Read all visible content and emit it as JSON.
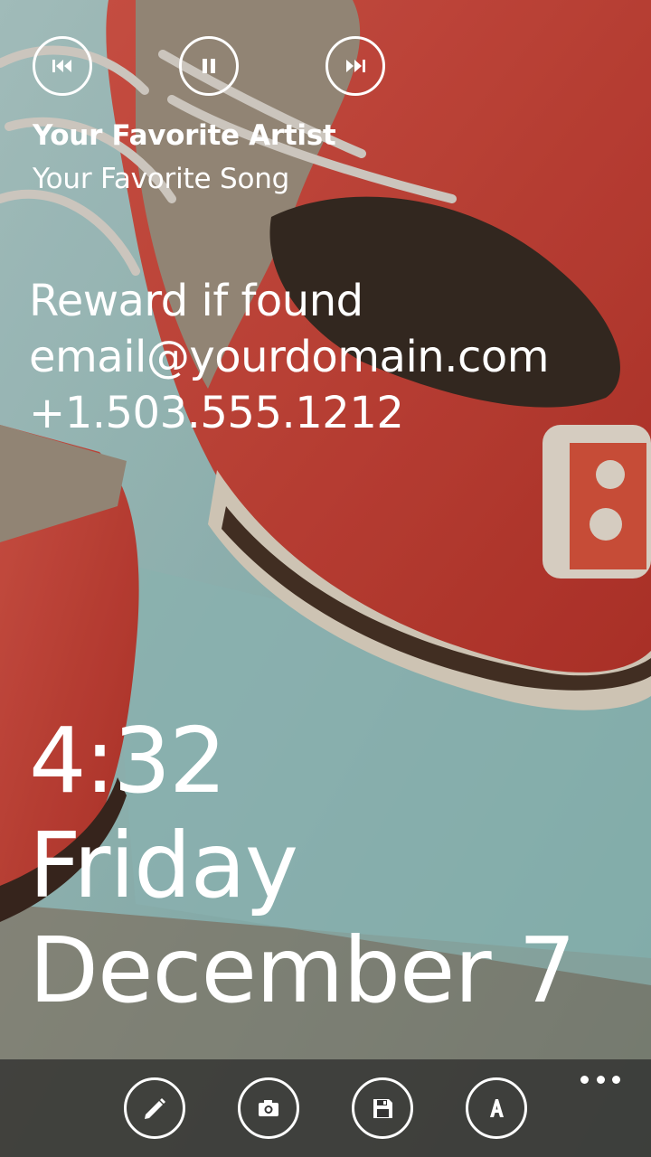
{
  "media": {
    "artist": "Your Favorite Artist",
    "song": "Your Favorite Song",
    "controls": [
      "previous-icon",
      "pause-icon",
      "next-icon"
    ]
  },
  "owner_info": {
    "line1": "Reward if found",
    "line2": "email@yourdomain.com",
    "line3": "+1.503.555.1212"
  },
  "clock": {
    "time": "4:32",
    "day": "Friday",
    "date": "December 7"
  },
  "app_bar": {
    "buttons": [
      "pencil-icon",
      "camera-icon",
      "save-icon",
      "font-icon"
    ],
    "more_icon": "more-icon"
  },
  "colors": {
    "shoe_red": "#d9473c",
    "background_teal": "#9fc6c5",
    "app_bar": "#282828"
  }
}
